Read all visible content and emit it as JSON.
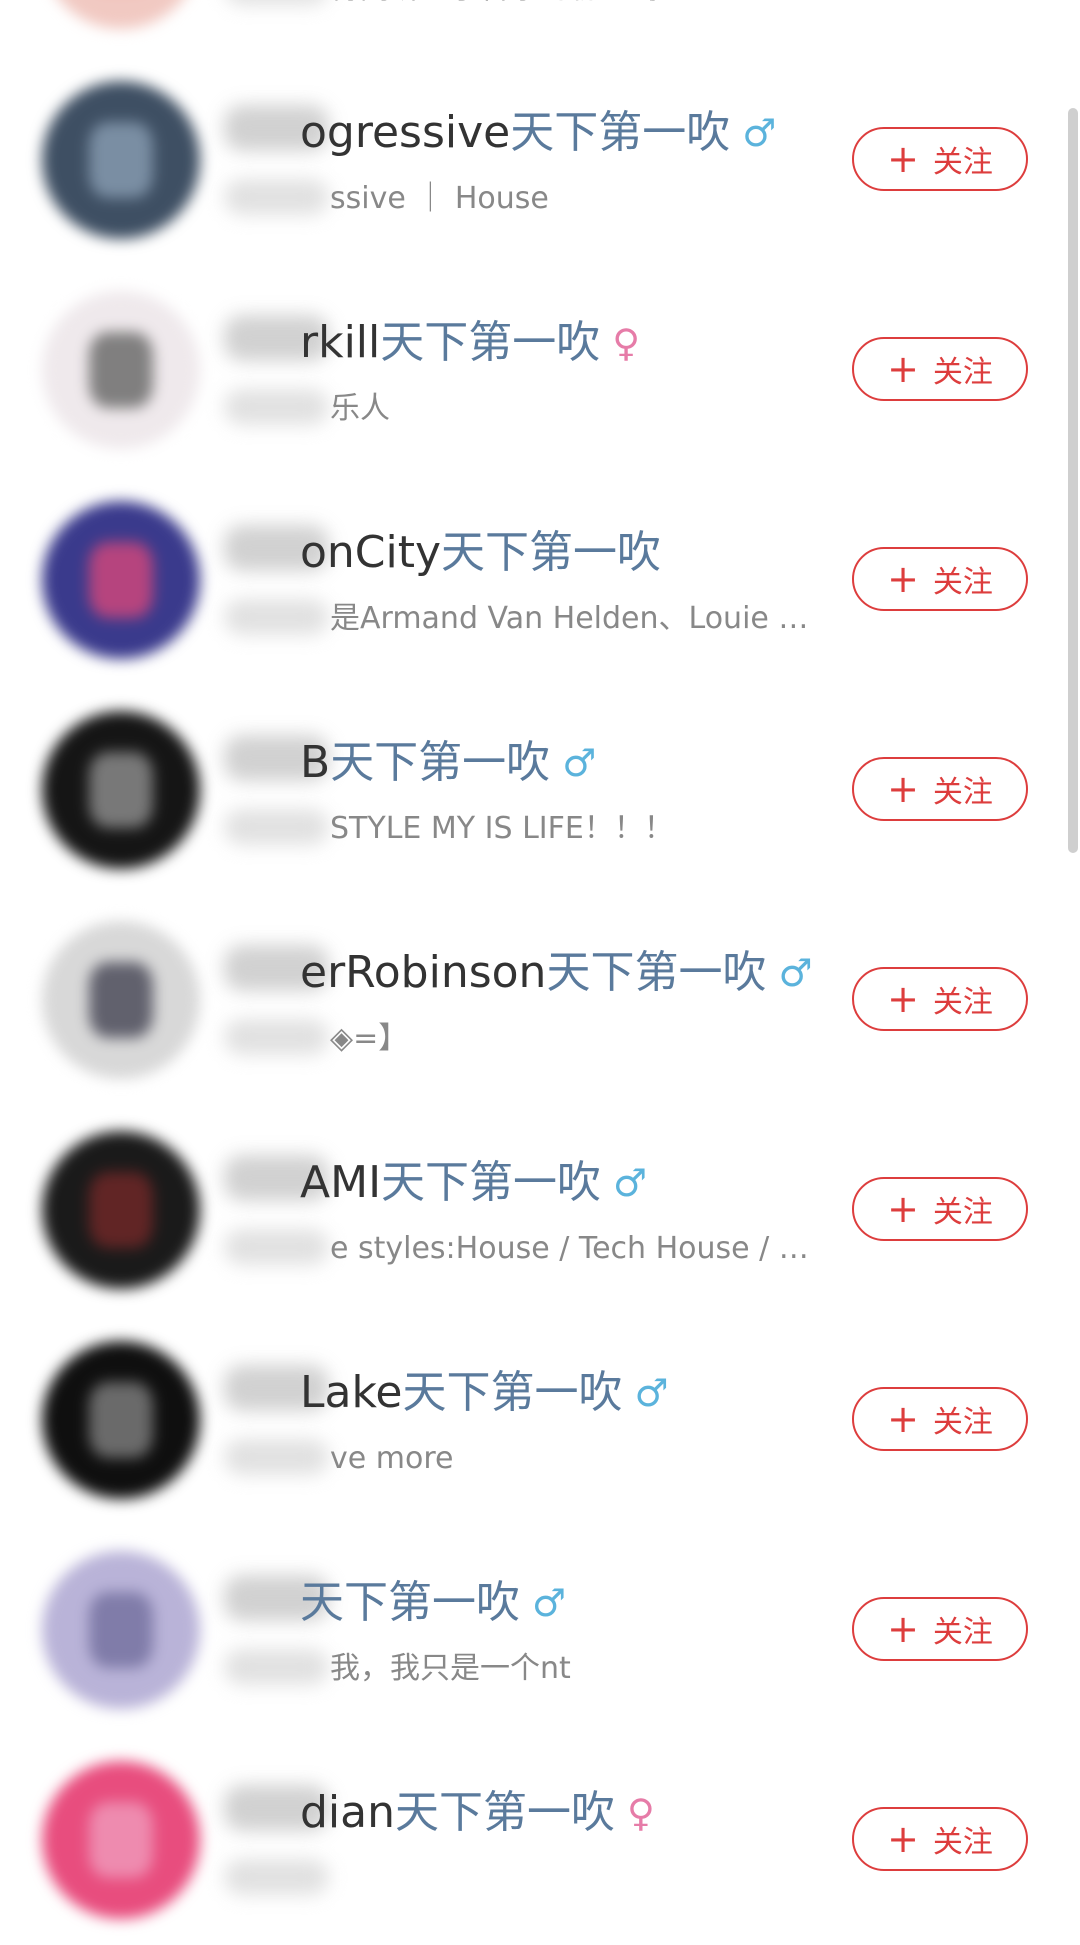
{
  "title_suffix": "天下第一吹",
  "follow_label": "关注",
  "follow_plus": "+",
  "gender_symbols": {
    "male": "♂",
    "female": "♀"
  },
  "users": [
    {
      "name": "",
      "gender": "female",
      "bio": "得刚听电子音乐的初心吗",
      "avatar_colors": [
        "#f1c9c2",
        "#e85c48"
      ]
    },
    {
      "name": "ogressive",
      "gender": "male",
      "bio": "ssive ｜ House",
      "avatar_colors": [
        "#3e4f63",
        "#8fa3b8"
      ]
    },
    {
      "name": "rkill",
      "gender": "female",
      "bio": "乐人",
      "avatar_colors": [
        "#efe9ec",
        "#5b5b5b"
      ]
    },
    {
      "name": "onCity",
      "gender": "",
      "bio": "是Armand Van Helden、Louie Vega",
      "avatar_colors": [
        "#3a3a8c",
        "#e0487a"
      ]
    },
    {
      "name": "B",
      "gender": "male",
      "bio": "STYLE MY IS LIFE！！！",
      "avatar_colors": [
        "#151515",
        "#9a9a9a"
      ]
    },
    {
      "name": "erRobinson",
      "gender": "male",
      "bio": "◈=】",
      "avatar_colors": [
        "#d8d8d8",
        "#3a3a4a"
      ]
    },
    {
      "name": "AMI",
      "gender": "male",
      "bio": "e styles:House / Tech House / Bass House",
      "avatar_colors": [
        "#1a1a1a",
        "#7a2a2a"
      ]
    },
    {
      "name": "Lake",
      "gender": "male",
      "bio": "ve more",
      "avatar_colors": [
        "#0f0f0f",
        "#8a8a8a"
      ]
    },
    {
      "name": "",
      "gender": "male",
      "bio": "我，我只是一个nt",
      "avatar_colors": [
        "#b9b3d8",
        "#6e6a9a"
      ]
    },
    {
      "name": "dian",
      "gender": "female",
      "bio": "",
      "avatar_colors": [
        "#e84d7e",
        "#f0a0c0"
      ]
    }
  ]
}
